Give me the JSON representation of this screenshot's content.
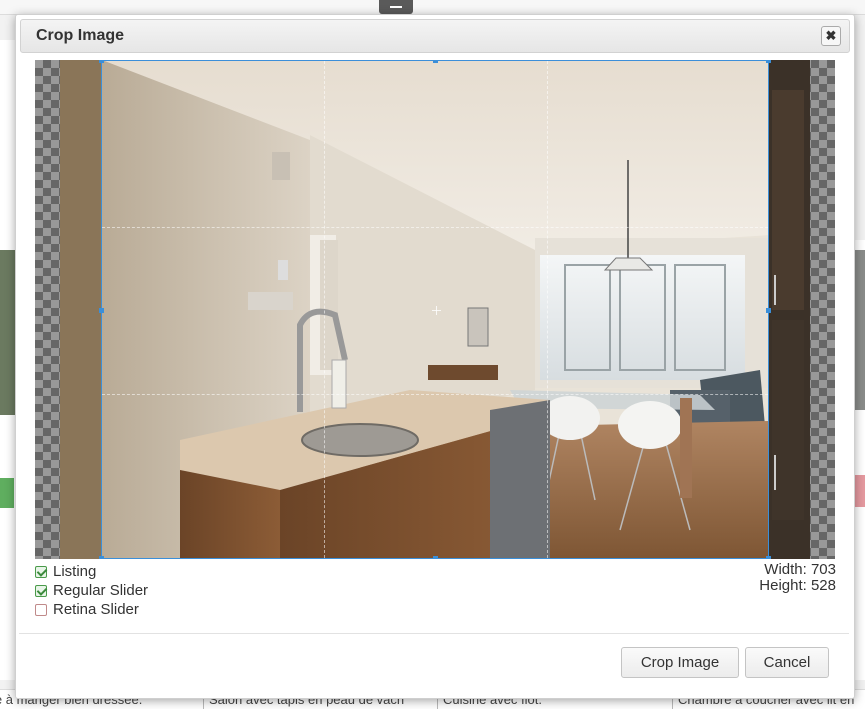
{
  "dialog": {
    "title": "Crop Image",
    "close_label": "✖"
  },
  "crop": {
    "width_label": "Width: 703",
    "height_label": "Height: 528"
  },
  "options": [
    {
      "label": "Listing",
      "checked": true
    },
    {
      "label": "Regular Slider",
      "checked": true
    },
    {
      "label": "Retina Slider",
      "checked": false
    }
  ],
  "buttons": {
    "crop": "Crop Image",
    "cancel": "Cancel"
  },
  "background_captions": [
    "le à manger bien dressée.",
    "Salon avec tapis en peau de vach",
    "Cuisine avec îlot.",
    "Chambre à coucher avec lit en"
  ],
  "colors": {
    "accent": "#3b8fd9",
    "check": "#3c8a3c"
  }
}
